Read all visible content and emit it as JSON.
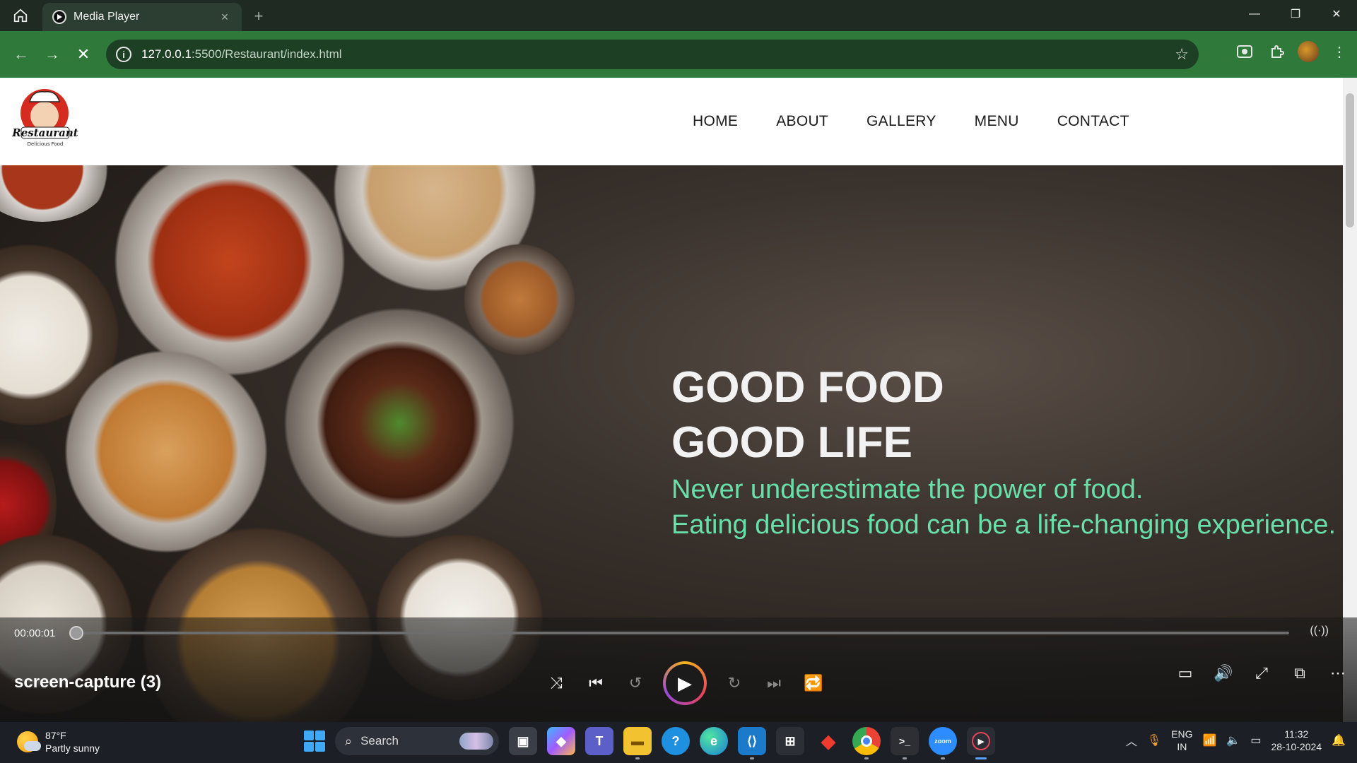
{
  "browser": {
    "tab_title": "Media Player",
    "tab_close": "×",
    "new_tab": "+",
    "url_host": "127.0.0.1",
    "url_path": ":5500/Restaurant/index.html",
    "window_controls": [
      "—",
      "❐",
      "✕"
    ]
  },
  "site": {
    "logo_text": "Restaurant",
    "logo_tagline": "Delicious Food",
    "nav": [
      "HOME",
      "ABOUT",
      "GALLERY",
      "MENU",
      "CONTACT"
    ],
    "hero": {
      "title_line1": "GOOD FOOD",
      "title_line2": "GOOD LIFE",
      "sub_line1": "Never underestimate the power of food.",
      "sub_line2": "Eating delicious food can be a life-changing experience."
    }
  },
  "player": {
    "time": "00:00:01",
    "media_title": "screen-capture (3)",
    "progress": 0.0,
    "accent": "#e8435a"
  },
  "taskbar": {
    "weather_temp": "87°F",
    "weather_desc": "Partly sunny",
    "search_label": "Search",
    "lang_line1": "ENG",
    "lang_line2": "IN",
    "clock_time": "11:32",
    "clock_date": "28-10-2024"
  },
  "colors": {
    "toolbar": "#2f7a3a",
    "hero_subtitle": "#67e0a9"
  }
}
